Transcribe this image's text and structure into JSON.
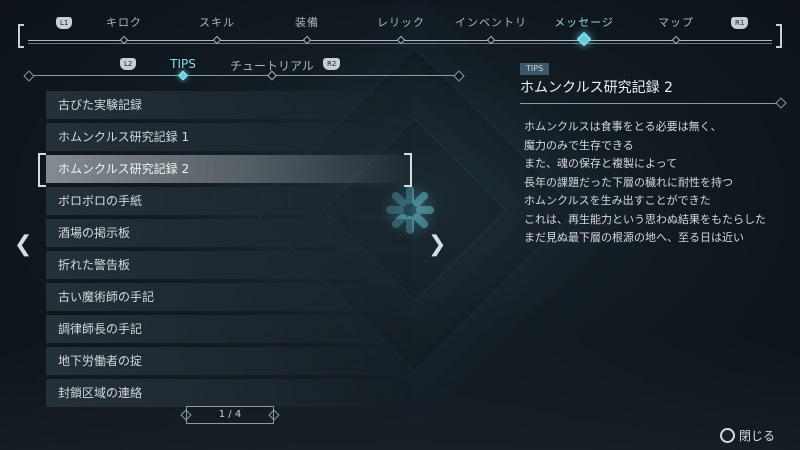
{
  "nav": {
    "left_hint": "L1",
    "right_hint": "R1",
    "tabs": [
      {
        "label": "キロク"
      },
      {
        "label": "スキル"
      },
      {
        "label": "装備"
      },
      {
        "label": "レリック"
      },
      {
        "label": "インベントリ"
      },
      {
        "label": "メッセージ",
        "active": true
      },
      {
        "label": "マップ"
      }
    ]
  },
  "subtabs": {
    "left_hint": "L2",
    "right_hint": "R2",
    "items": [
      {
        "label": "TIPS",
        "active": true
      },
      {
        "label": "チュートリアル"
      }
    ]
  },
  "list": {
    "items": [
      {
        "label": "古びた実験記録"
      },
      {
        "label": "ホムンクルス研究記録 1"
      },
      {
        "label": "ホムンクルス研究記録 2",
        "selected": true
      },
      {
        "label": "ボロボロの手紙"
      },
      {
        "label": "酒場の掲示板"
      },
      {
        "label": "折れた警告板"
      },
      {
        "label": "古い魔術師の手記"
      },
      {
        "label": "調律師長の手記"
      },
      {
        "label": "地下労働者の掟"
      },
      {
        "label": "封鎖区域の連絡"
      }
    ],
    "page": "1 / 4"
  },
  "detail": {
    "tag": "TIPS",
    "title": "ホムンクルス研究記録 2",
    "lines": [
      "ホムンクルスは食事をとる必要は無く、",
      "魔力のみで生存できる",
      "また、魂の保存と複製によって",
      "長年の課題だった下層の穢れに耐性を持つ",
      "ホムンクルスを生み出すことができた",
      "これは、再生能力という思わぬ結果をもたらした",
      "まだ見ぬ最下層の根源の地へ、至る日は近い"
    ]
  },
  "footer": {
    "close_label": "閉じる"
  },
  "colors": {
    "accent": "#5fd0e0",
    "selected_row": "#969fa5"
  }
}
